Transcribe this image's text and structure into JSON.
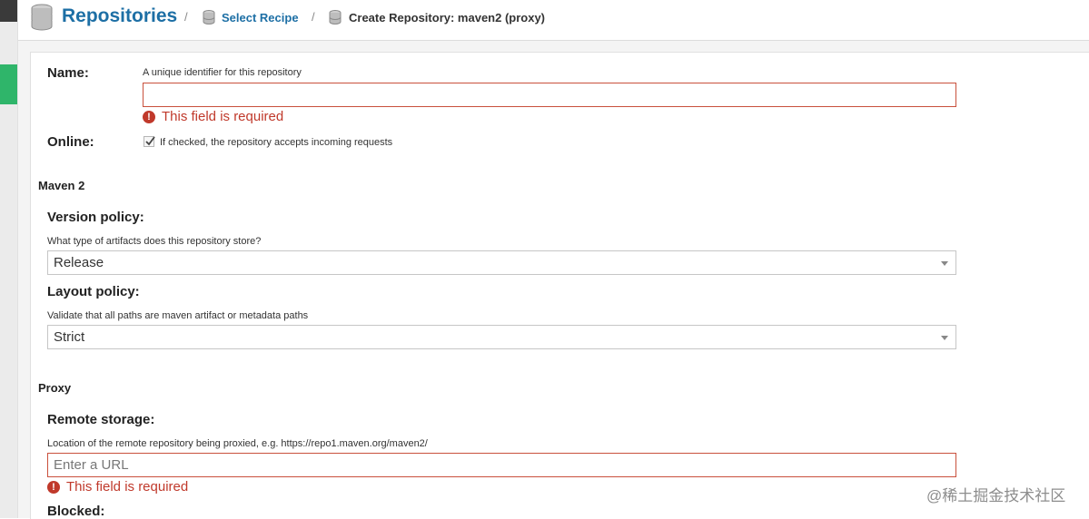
{
  "header": {
    "title": "Repositories",
    "separator": "/",
    "select_recipe": "Select Recipe",
    "current_page": "Create Repository: maven2 (proxy)"
  },
  "form": {
    "name": {
      "label": "Name:",
      "hint": "A unique identifier for this repository",
      "value": "",
      "error": "This field is required"
    },
    "online": {
      "label": "Online:",
      "checked": true,
      "hint": "If checked, the repository accepts incoming requests"
    },
    "maven2": {
      "section_title": "Maven 2",
      "version_policy": {
        "label": "Version policy:",
        "hint": "What type of artifacts does this repository store?",
        "selected": "Release"
      },
      "layout_policy": {
        "label": "Layout policy:",
        "hint": "Validate that all paths are maven artifact or metadata paths",
        "selected": "Strict"
      }
    },
    "proxy": {
      "section_title": "Proxy",
      "remote_storage": {
        "label": "Remote storage:",
        "hint": "Location of the remote repository being proxied, e.g. https://repo1.maven.org/maven2/",
        "placeholder": "Enter a URL",
        "value": "",
        "error": "This field is required"
      },
      "blocked": {
        "label": "Blocked:"
      }
    }
  },
  "watermark": "@稀土掘金技术社区",
  "colors": {
    "accent": "#1d6fa5",
    "error": "#c0392b",
    "sidebar_active": "#2fb56a"
  }
}
